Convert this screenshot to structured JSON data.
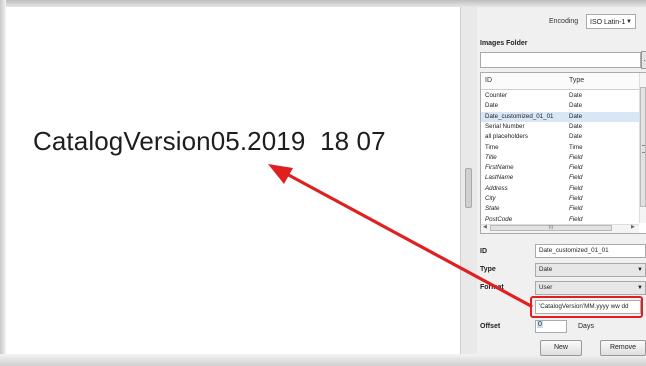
{
  "document": {
    "text": "CatalogVersion05.2019  18 07"
  },
  "panel": {
    "encoding_label": "Encoding",
    "encoding_value": "ISO Latin-1",
    "images_folder_label": "Images Folder",
    "images_folder_value": "",
    "browse_label": "...",
    "list": {
      "columns": [
        "ID",
        "Type"
      ],
      "rows": [
        {
          "id": "Counter",
          "type": "Date"
        },
        {
          "id": "Date",
          "type": "Date"
        },
        {
          "id": "Date_customized_01_01",
          "type": "Date"
        },
        {
          "id": "Serial Number",
          "type": "Date"
        },
        {
          "id": "all placeholders",
          "type": "Date"
        },
        {
          "id": "Time",
          "type": "Time"
        },
        {
          "id": "Title",
          "type": "Field"
        },
        {
          "id": "FirstName",
          "type": "Field"
        },
        {
          "id": "LastName",
          "type": "Field"
        },
        {
          "id": "Address",
          "type": "Field"
        },
        {
          "id": "City",
          "type": "Field"
        },
        {
          "id": "State",
          "type": "Field"
        },
        {
          "id": "PostCode",
          "type": "Field"
        }
      ],
      "selected_row": "Date_customized_01_01"
    },
    "id_label": "ID",
    "id_value": "Date_customized_01_01",
    "type_label": "Type",
    "type_value": "Date",
    "format_label": "Format",
    "format_value": "User",
    "format_string": "'CatalogVersion'MM.yyyy  ww dd",
    "offset_label": "Offset",
    "offset_value": "0",
    "offset_unit": "Days",
    "new_button": "New",
    "remove_button": "Remove"
  },
  "colors": {
    "highlight": "#e02020",
    "selection": "#d9e6f6"
  }
}
